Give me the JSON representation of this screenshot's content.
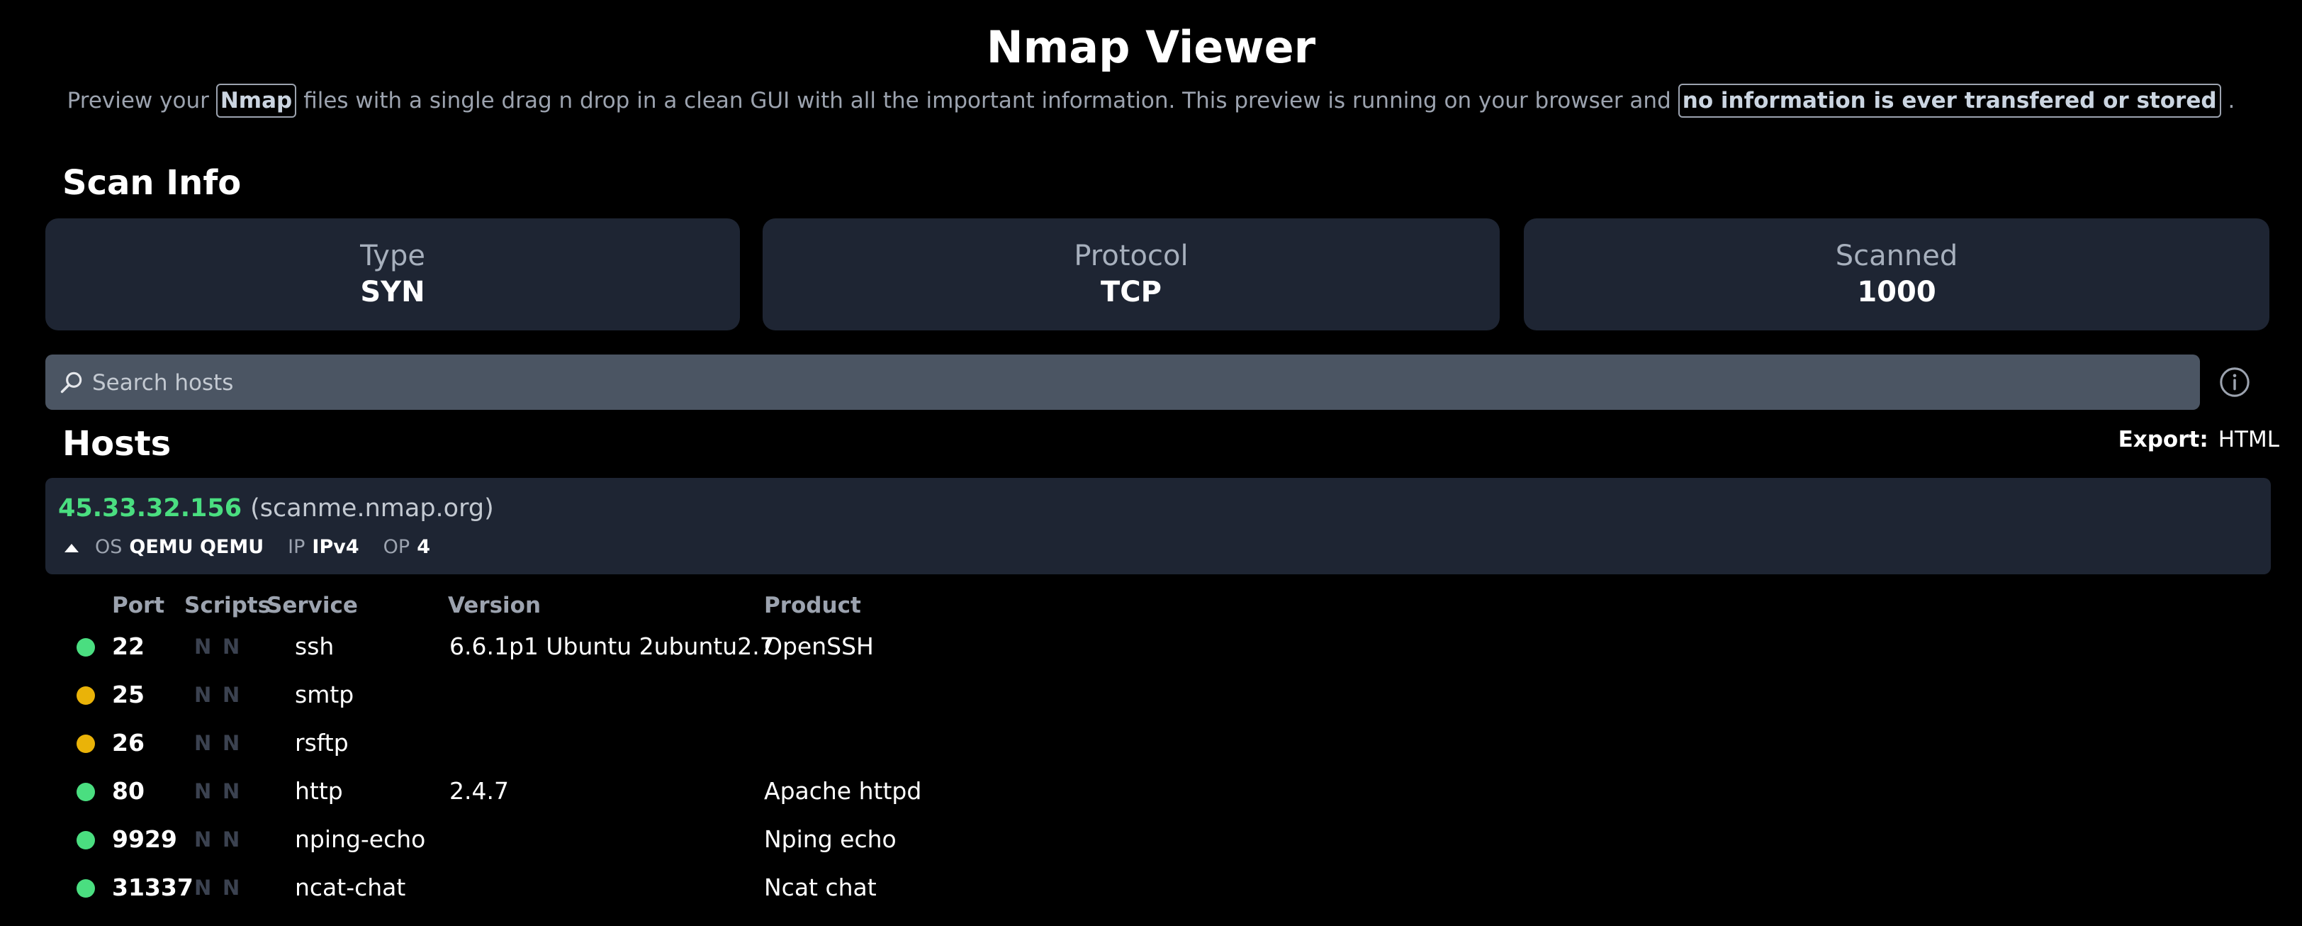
{
  "header": {
    "title": "Nmap Viewer",
    "subtitle_pre": "Preview your",
    "subtitle_highlight1": "Nmap",
    "subtitle_mid": "files with a single drag n drop in a clean GUI with all the important information. This preview is running on your browser and",
    "subtitle_highlight2": "no information is ever transfered or stored",
    "subtitle_end": "."
  },
  "scan_info": {
    "heading": "Scan Info",
    "cards": [
      {
        "label": "Type",
        "value": "SYN"
      },
      {
        "label": "Protocol",
        "value": "TCP"
      },
      {
        "label": "Scanned",
        "value": "1000"
      }
    ]
  },
  "search": {
    "placeholder": "Search hosts",
    "value": ""
  },
  "hosts_section": {
    "heading": "Hosts",
    "export_label": "Export:",
    "export_option": "HTML"
  },
  "host": {
    "ip": "45.33.32.156",
    "hostname": "(scanme.nmap.org)",
    "os_label": "OS",
    "os_value": "QEMU QEMU",
    "ip_label": "IP",
    "ip_value": "IPv4",
    "op_label": "OP",
    "op_value": "4"
  },
  "ports_table": {
    "headers": {
      "port": "Port",
      "scripts": "Scripts",
      "service": "Service",
      "version": "Version",
      "product": "Product"
    },
    "rows": [
      {
        "state_color": "#4ade80",
        "port": "22",
        "script1": "N",
        "script2": "N",
        "service": "ssh",
        "version": "6.6.1p1 Ubuntu 2ubuntu2.7",
        "product": "OpenSSH"
      },
      {
        "state_color": "#eab308",
        "port": "25",
        "script1": "N",
        "script2": "N",
        "service": "smtp",
        "version": "",
        "product": ""
      },
      {
        "state_color": "#eab308",
        "port": "26",
        "script1": "N",
        "script2": "N",
        "service": "rsftp",
        "version": "",
        "product": ""
      },
      {
        "state_color": "#4ade80",
        "port": "80",
        "script1": "N",
        "script2": "N",
        "service": "http",
        "version": "2.4.7",
        "product": "Apache httpd"
      },
      {
        "state_color": "#4ade80",
        "port": "9929",
        "script1": "N",
        "script2": "N",
        "service": "nping-echo",
        "version": "",
        "product": "Nping echo"
      },
      {
        "state_color": "#4ade80",
        "port": "31337",
        "script1": "N",
        "script2": "N",
        "service": "ncat-chat",
        "version": "",
        "product": "Ncat chat"
      }
    ]
  },
  "icons": {
    "search": "search-icon",
    "info": "info-icon",
    "collapse": "caret-up-icon"
  }
}
